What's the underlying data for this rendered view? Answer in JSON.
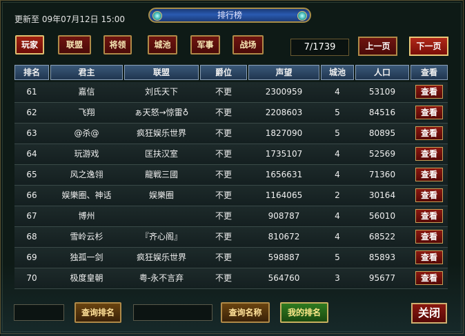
{
  "header": {
    "updated": "更新至 09年07月12日 15:00",
    "title": "排行榜"
  },
  "tabs": [
    "玩家",
    "联盟",
    "将领",
    "城池",
    "军事",
    "战场"
  ],
  "pager": {
    "info": "7/1739",
    "prev": "上一页",
    "next": "下一页"
  },
  "columns": [
    "排名",
    "君主",
    "联盟",
    "爵位",
    "声望",
    "城池",
    "人口",
    "查看"
  ],
  "rows": [
    {
      "rank": "61",
      "lord": "嘉信",
      "alliance": "刘氏天下",
      "title": "不更",
      "prestige": "2300959",
      "cities": "4",
      "pop": "53109",
      "view": "查看"
    },
    {
      "rank": "62",
      "lord": "飞翔",
      "alliance": "ぁ天怒→惊雷♁",
      "title": "不更",
      "prestige": "2208603",
      "cities": "5",
      "pop": "84516",
      "view": "查看"
    },
    {
      "rank": "63",
      "lord": "@杀@",
      "alliance": "疯狂娱乐世界",
      "title": "不更",
      "prestige": "1827090",
      "cities": "5",
      "pop": "80895",
      "view": "查看"
    },
    {
      "rank": "64",
      "lord": "玩游戏",
      "alliance": "匡扶汉室",
      "title": "不更",
      "prestige": "1735107",
      "cities": "4",
      "pop": "52569",
      "view": "查看"
    },
    {
      "rank": "65",
      "lord": "风之逸翎",
      "alliance": "龍戦三國",
      "title": "不更",
      "prestige": "1656631",
      "cities": "4",
      "pop": "71360",
      "view": "查看"
    },
    {
      "rank": "66",
      "lord": "娱樂圈、神话",
      "alliance": "娱樂圈",
      "title": "不更",
      "prestige": "1164065",
      "cities": "2",
      "pop": "30164",
      "view": "查看"
    },
    {
      "rank": "67",
      "lord": "博州",
      "alliance": "",
      "title": "不更",
      "prestige": "908787",
      "cities": "4",
      "pop": "56010",
      "view": "查看"
    },
    {
      "rank": "68",
      "lord": "雪岭云杉",
      "alliance": "『齐心阁』",
      "title": "不更",
      "prestige": "810672",
      "cities": "4",
      "pop": "68522",
      "view": "查看"
    },
    {
      "rank": "69",
      "lord": "独孤一剑",
      "alliance": "疯狂娱乐世界",
      "title": "不更",
      "prestige": "598887",
      "cities": "5",
      "pop": "85893",
      "view": "查看"
    },
    {
      "rank": "70",
      "lord": "极度皇朝",
      "alliance": "粤-永不言弃",
      "title": "不更",
      "prestige": "564760",
      "cities": "3",
      "pop": "95677",
      "view": "查看"
    }
  ],
  "bottom": {
    "rank_input": "",
    "query_rank": "查询排名",
    "name_input": "",
    "query_name": "查询名称",
    "my_rank": "我的排名",
    "close": "关闭"
  }
}
